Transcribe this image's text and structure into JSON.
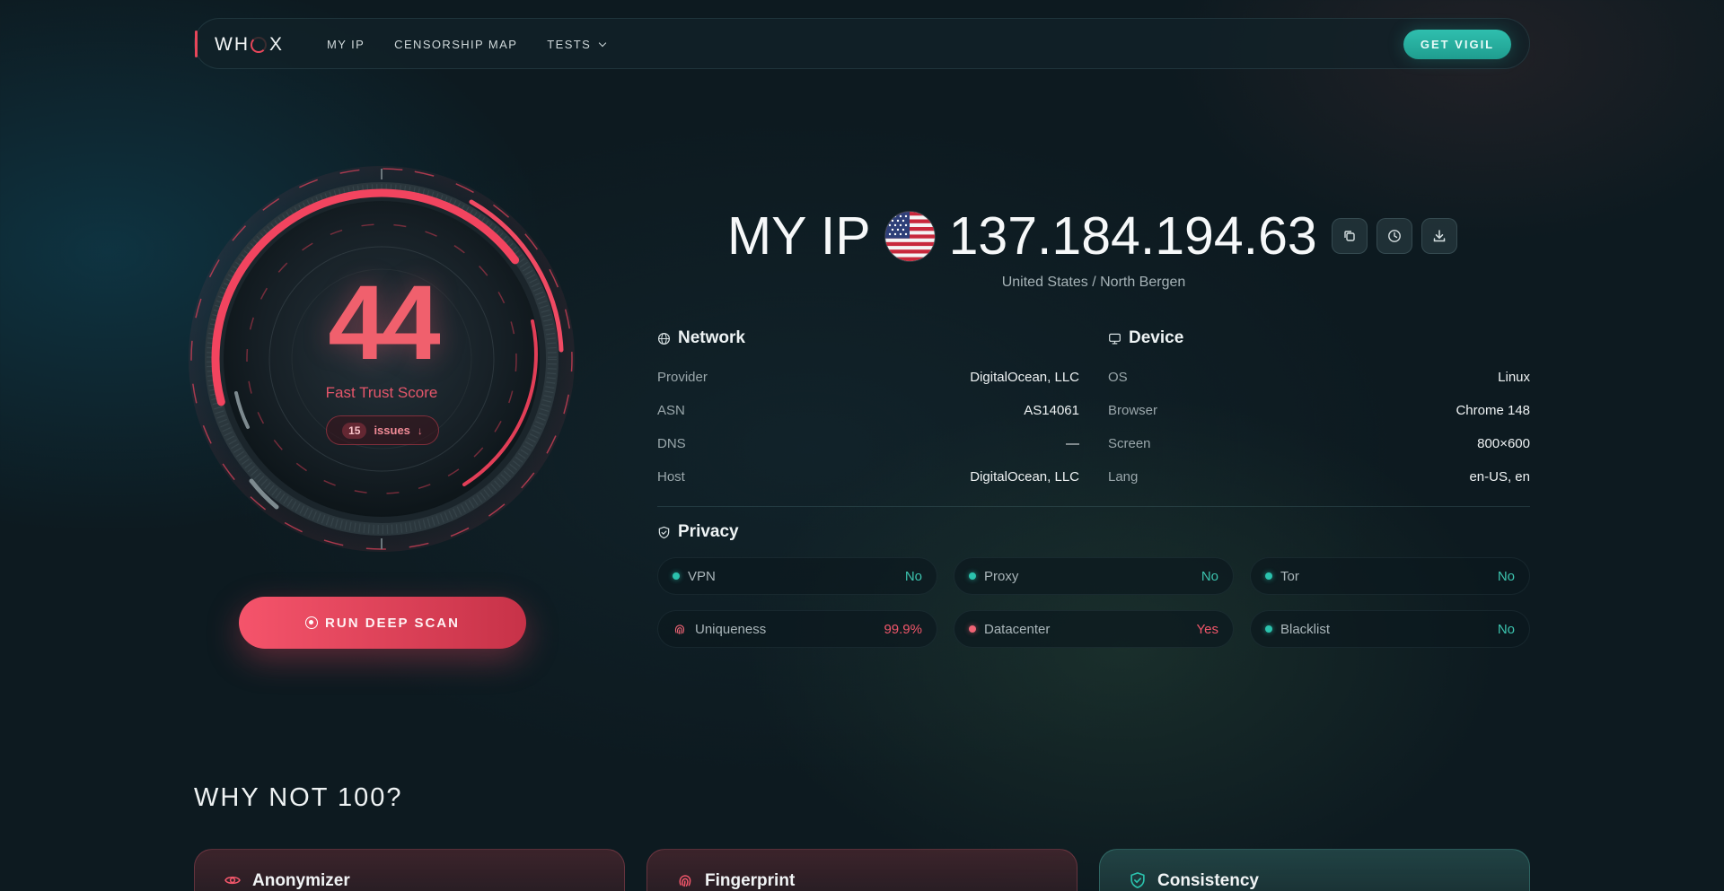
{
  "nav": {
    "logo_left": "WH",
    "logo_right": "X",
    "links": [
      {
        "label": "MY IP"
      },
      {
        "label": "CENSORSHIP MAP"
      },
      {
        "label": "TESTS"
      }
    ],
    "cta": "GET VIGIL"
  },
  "score": {
    "value": "44",
    "value_fraction": 0.44,
    "label": "Fast Trust Score",
    "issues_count": "15",
    "issues_label": "issues",
    "issues_arrow": "↓",
    "accent_color": "#f0606d"
  },
  "scan_button": "RUN DEEP SCAN",
  "ip": {
    "prefix": "MY IP",
    "value": "137.184.194.63",
    "flag": "us-flag",
    "location": "United States / North Bergen",
    "actions": [
      "copy-icon",
      "history-icon",
      "download-icon"
    ]
  },
  "network": {
    "title": "Network",
    "rows": [
      {
        "k": "Provider",
        "v": "DigitalOcean, LLC"
      },
      {
        "k": "ASN",
        "v": "AS14061"
      },
      {
        "k": "DNS",
        "v": "—"
      },
      {
        "k": "Host",
        "v": "DigitalOcean, LLC"
      }
    ]
  },
  "device": {
    "title": "Device",
    "rows": [
      {
        "k": "OS",
        "v": "Linux"
      },
      {
        "k": "Browser",
        "v": "Chrome 148"
      },
      {
        "k": "Screen",
        "v": "800×600"
      },
      {
        "k": "Lang",
        "v": "en-US, en"
      }
    ]
  },
  "privacy": {
    "title": "Privacy",
    "chips": [
      {
        "k": "VPN",
        "v": "No",
        "status": "ok"
      },
      {
        "k": "Proxy",
        "v": "No",
        "status": "ok"
      },
      {
        "k": "Tor",
        "v": "No",
        "status": "ok"
      },
      {
        "k": "Uniqueness",
        "v": "99.9%",
        "status": "bad"
      },
      {
        "k": "Datacenter",
        "v": "Yes",
        "status": "bad"
      },
      {
        "k": "Blacklist",
        "v": "No",
        "status": "ok"
      }
    ]
  },
  "why": {
    "title": "WHY NOT 100?",
    "cards": [
      {
        "label": "Anonymizer",
        "icon": "eye-icon"
      },
      {
        "label": "Fingerprint",
        "icon": "fingerprint-icon"
      },
      {
        "label": "Consistency",
        "icon": "shield-check-icon"
      }
    ]
  },
  "colors": {
    "accent_red": "#e7465a",
    "accent_teal": "#2bc2ad",
    "background": "#0d1a20"
  }
}
